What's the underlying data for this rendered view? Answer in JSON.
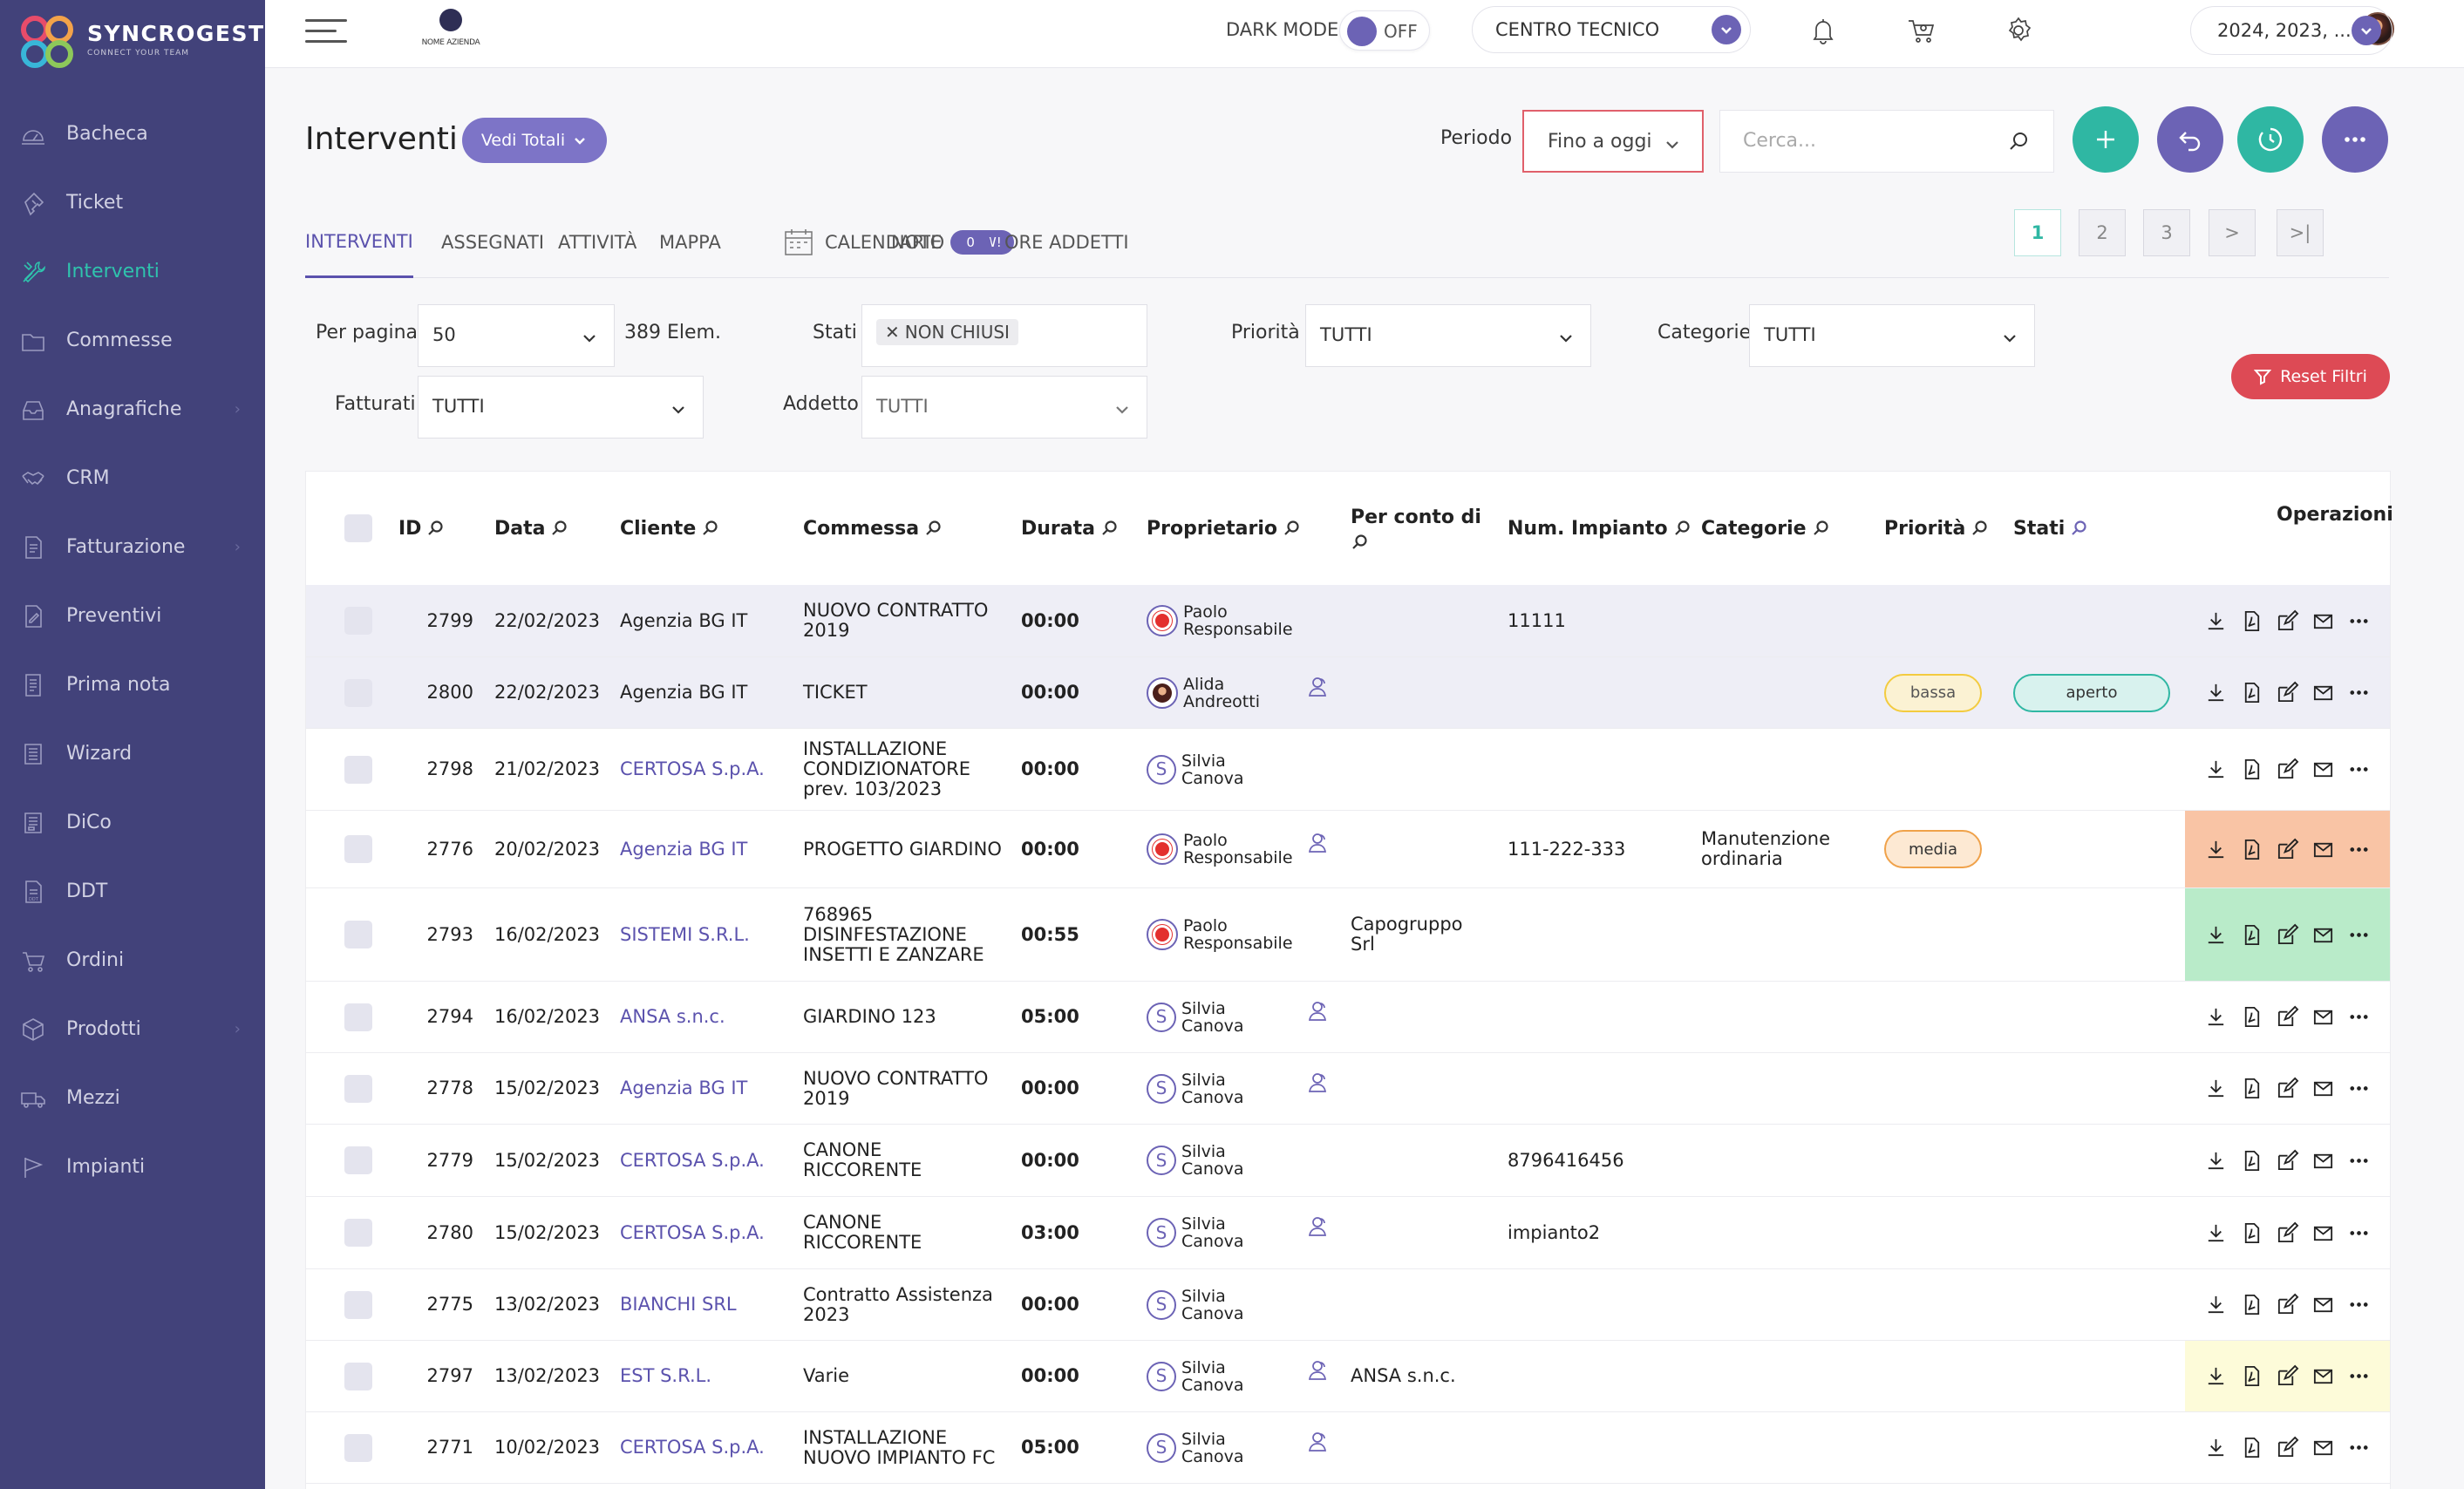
{
  "brand": {
    "name": "SYNCROGEST",
    "tagline": "CONNECT YOUR TEAM"
  },
  "sidebar": {
    "items": [
      {
        "label": "Bacheca",
        "icon": "dashboard-icon"
      },
      {
        "label": "Ticket",
        "icon": "ticket-icon"
      },
      {
        "label": "Interventi",
        "icon": "tools-icon",
        "active": true
      },
      {
        "label": "Commesse",
        "icon": "folder-icon"
      },
      {
        "label": "Anagrafiche",
        "icon": "inbox-icon",
        "arrow": "›"
      },
      {
        "label": "CRM",
        "icon": "handshake-icon"
      },
      {
        "label": "Fatturazione",
        "icon": "invoice-icon",
        "arrow": "›"
      },
      {
        "label": "Preventivi",
        "icon": "quote-icon"
      },
      {
        "label": "Prima nota",
        "icon": "notes-icon"
      },
      {
        "label": "Wizard",
        "icon": "list-icon"
      },
      {
        "label": "DiCo",
        "icon": "document-icon"
      },
      {
        "label": "DDT",
        "icon": "ddt-icon"
      },
      {
        "label": "Ordini",
        "icon": "cart-icon"
      },
      {
        "label": "Prodotti",
        "icon": "box-icon",
        "arrow": "›"
      },
      {
        "label": "Mezzi",
        "icon": "truck-icon"
      },
      {
        "label": "Impianti",
        "icon": "flag-icon"
      }
    ]
  },
  "topbar": {
    "company_logo_text": "NOME AZIENDA",
    "dark_mode_label": "DARK MODE",
    "dark_mode_state": "OFF",
    "center_select": "CENTRO TECNICO",
    "year_select": "2024, 2023, ..."
  },
  "page": {
    "title": "Interventi",
    "vedi_totali": "Vedi Totali",
    "periodo_label": "Periodo",
    "periodo_value": "Fino a oggi",
    "search_placeholder": "Cerca...",
    "accent": "#6c63b5",
    "teal": "#2fb7a3"
  },
  "tabs": [
    {
      "label": "INTERVENTI",
      "active": true
    },
    {
      "label": "ASSEGNATI"
    },
    {
      "label": "ATTIVITÀ"
    },
    {
      "label": "MAPPA"
    },
    {
      "label": "CALENDARIO",
      "badge": "NEW!"
    },
    {
      "label": "NOTE",
      "badge": "0"
    },
    {
      "label": "ORE ADDETTI"
    }
  ],
  "pagination": [
    "1",
    "2",
    "3",
    ">",
    ">|"
  ],
  "filters": {
    "per_pagina_label": "Per pagina",
    "per_pagina_value": "50",
    "count": "389 Elem.",
    "stati_label": "Stati",
    "stati_chip": "NON CHIUSI",
    "priorita_label": "Priorità",
    "priorita_value": "TUTTI",
    "categorie_label": "Categorie",
    "categorie_value": "TUTTI",
    "fatturati_label": "Fatturati",
    "fatturati_value": "TUTTI",
    "addetto_label": "Addetto",
    "addetto_value": "TUTTI",
    "reset": "Reset Filtri"
  },
  "table": {
    "headers": {
      "id": "ID",
      "data": "Data",
      "cliente": "Cliente",
      "commessa": "Commessa",
      "durata": "Durata",
      "proprietario": "Proprietario",
      "per_conto_di": "Per conto di",
      "num_impianto": "Num. Impianto",
      "categorie": "Categorie",
      "priorita": "Priorità",
      "stati": "Stati",
      "operazioni": "Operazioni"
    },
    "rows": [
      {
        "id": "2799",
        "data": "22/02/2023",
        "cliente": "Agenzia BG IT",
        "cliente_link": false,
        "commessa": "NUOVO CONTRATTO 2019",
        "durata": "00:00",
        "owner1": "Paolo",
        "owner2": "Responsabile",
        "avatar": "logo",
        "group": false,
        "per_conto": "",
        "impianto": "11111",
        "categoria": "",
        "priorita": "",
        "stato": "",
        "hl": true,
        "opbg": ""
      },
      {
        "id": "2800",
        "data": "22/02/2023",
        "cliente": "Agenzia BG IT",
        "cliente_link": false,
        "commessa": "TICKET",
        "durata": "00:00",
        "owner1": "Alida",
        "owner2": "Andreotti",
        "avatar": "photo",
        "group": true,
        "per_conto": "",
        "impianto": "",
        "categoria": "",
        "priorita": "bassa",
        "stato": "aperto",
        "hl": true,
        "opbg": ""
      },
      {
        "id": "2798",
        "data": "21/02/2023",
        "cliente": "CERTOSA S.p.A.",
        "cliente_link": true,
        "commessa": "INSTALLAZIONE CONDIZIONATORE prev. 103/2023",
        "durata": "00:00",
        "owner1": "Silvia",
        "owner2": "Canova",
        "avatar": "S",
        "group": false,
        "per_conto": "",
        "impianto": "",
        "categoria": "",
        "priorita": "",
        "stato": "",
        "hl": false,
        "opbg": ""
      },
      {
        "id": "2776",
        "data": "20/02/2023",
        "cliente": "Agenzia BG IT",
        "cliente_link": true,
        "commessa": "PROGETTO GIARDINO",
        "durata": "00:00",
        "owner1": "Paolo",
        "owner2": "Responsabile",
        "avatar": "logo",
        "group": true,
        "per_conto": "",
        "impianto": "111-222-333",
        "categoria": "Manutenzione ordinaria",
        "priorita": "media",
        "stato": "",
        "hl": false,
        "opbg": "#f9c4a5"
      },
      {
        "id": "2793",
        "data": "16/02/2023",
        "cliente": "SISTEMI S.R.L.",
        "cliente_link": true,
        "commessa": "768965 DISINFESTAZIONE INSETTI E ZANZARE",
        "durata": "00:55",
        "owner1": "Paolo",
        "owner2": "Responsabile",
        "avatar": "logo",
        "group": false,
        "per_conto": "Capogruppo Srl",
        "impianto": "",
        "categoria": "",
        "priorita": "",
        "stato": "",
        "hl": false,
        "opbg": "#b9ebc9"
      },
      {
        "id": "2794",
        "data": "16/02/2023",
        "cliente": "ANSA s.n.c.",
        "cliente_link": true,
        "commessa": "GIARDINO 123",
        "durata": "05:00",
        "owner1": "Silvia",
        "owner2": "Canova",
        "avatar": "S",
        "group": true,
        "per_conto": "",
        "impianto": "",
        "categoria": "",
        "priorita": "",
        "stato": "",
        "hl": false,
        "opbg": ""
      },
      {
        "id": "2778",
        "data": "15/02/2023",
        "cliente": "Agenzia BG IT",
        "cliente_link": true,
        "commessa": "NUOVO CONTRATTO 2019",
        "durata": "00:00",
        "owner1": "Silvia",
        "owner2": "Canova",
        "avatar": "S",
        "group": true,
        "per_conto": "",
        "impianto": "",
        "categoria": "",
        "priorita": "",
        "stato": "",
        "hl": false,
        "opbg": ""
      },
      {
        "id": "2779",
        "data": "15/02/2023",
        "cliente": "CERTOSA S.p.A.",
        "cliente_link": true,
        "commessa": "CANONE RICCORENTE",
        "durata": "00:00",
        "owner1": "Silvia",
        "owner2": "Canova",
        "avatar": "S",
        "group": false,
        "per_conto": "",
        "impianto": "8796416456",
        "categoria": "",
        "priorita": "",
        "stato": "",
        "hl": false,
        "opbg": ""
      },
      {
        "id": "2780",
        "data": "15/02/2023",
        "cliente": "CERTOSA S.p.A.",
        "cliente_link": true,
        "commessa": "CANONE RICCORENTE",
        "durata": "03:00",
        "owner1": "Silvia",
        "owner2": "Canova",
        "avatar": "S",
        "group": true,
        "per_conto": "",
        "impianto": "impianto2",
        "categoria": "",
        "priorita": "",
        "stato": "",
        "hl": false,
        "opbg": ""
      },
      {
        "id": "2775",
        "data": "13/02/2023",
        "cliente": "BIANCHI SRL",
        "cliente_link": true,
        "commessa": "Contratto Assistenza 2023",
        "durata": "00:00",
        "owner1": "Silvia",
        "owner2": "Canova",
        "avatar": "S",
        "group": false,
        "per_conto": "",
        "impianto": "",
        "categoria": "",
        "priorita": "",
        "stato": "",
        "hl": false,
        "opbg": ""
      },
      {
        "id": "2797",
        "data": "13/02/2023",
        "cliente": "EST S.R.L.",
        "cliente_link": true,
        "commessa": "Varie",
        "durata": "00:00",
        "owner1": "Silvia",
        "owner2": "Canova",
        "avatar": "S",
        "group": true,
        "per_conto": "ANSA s.n.c.",
        "impianto": "",
        "categoria": "",
        "priorita": "",
        "stato": "",
        "hl": false,
        "opbg": "#fdfbd9"
      },
      {
        "id": "2771",
        "data": "10/02/2023",
        "cliente": "CERTOSA S.p.A.",
        "cliente_link": true,
        "commessa": "INSTALLAZIONE NUOVO IMPIANTO FC",
        "durata": "05:00",
        "owner1": "Silvia",
        "owner2": "Canova",
        "avatar": "S",
        "group": true,
        "per_conto": "",
        "impianto": "",
        "categoria": "",
        "priorita": "",
        "stato": "",
        "hl": false,
        "opbg": ""
      }
    ]
  }
}
